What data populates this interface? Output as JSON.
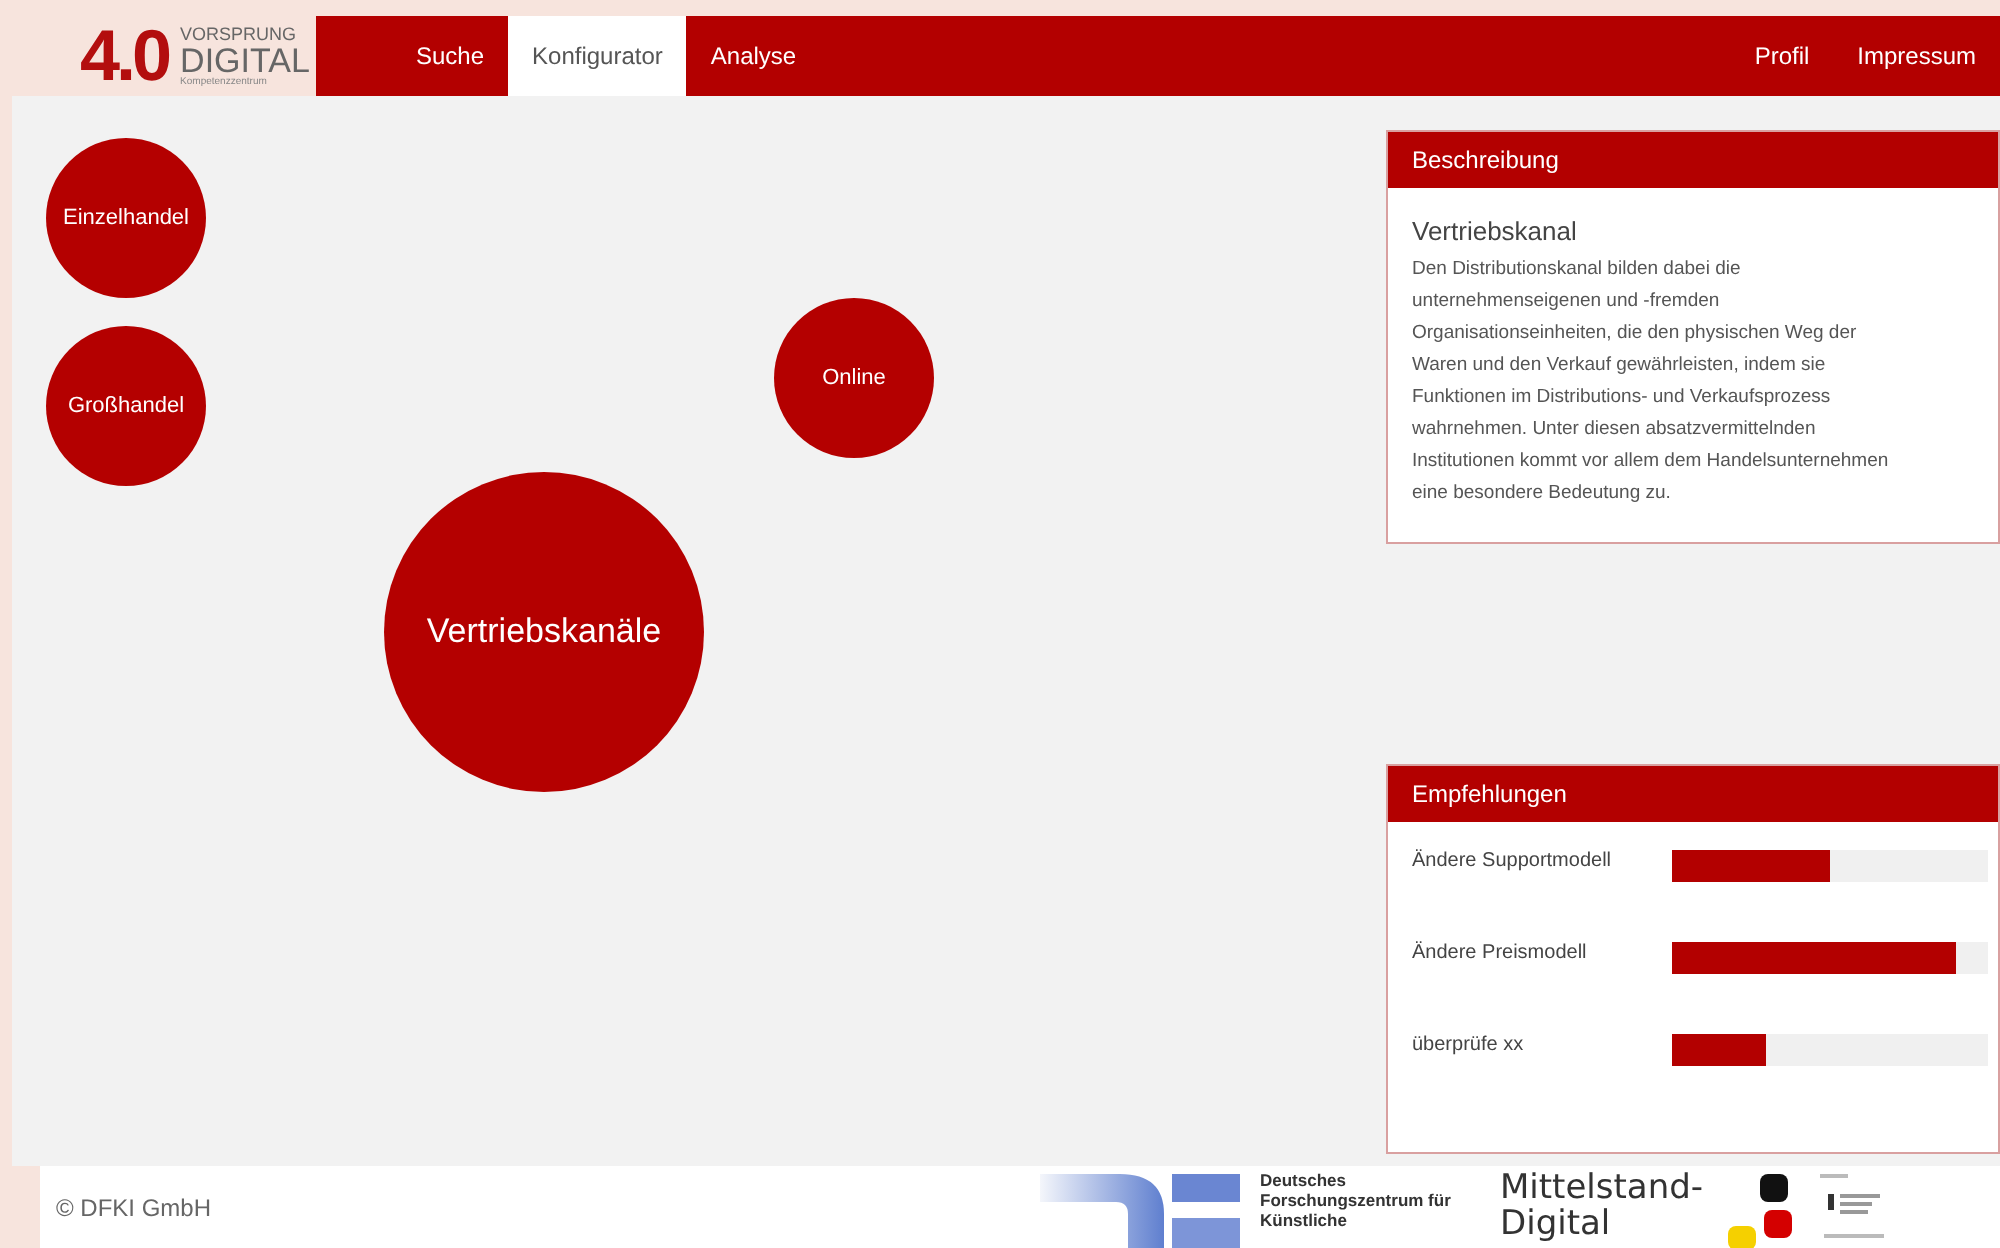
{
  "logo": {
    "number": "4.0",
    "line_1": "VORSPRUNG",
    "line_2": "DIGITAL",
    "line_3": "Kompetenzzentrum"
  },
  "nav": {
    "items": [
      {
        "label": "Suche",
        "selected": false
      },
      {
        "label": "Konfigurator",
        "selected": true
      },
      {
        "label": "Analyse",
        "selected": false
      }
    ],
    "right_items": [
      "Profil",
      "Impressum"
    ]
  },
  "nodes": [
    {
      "label": "Einzelhandel",
      "kind": "option"
    },
    {
      "label": "Großhandel",
      "kind": "option"
    },
    {
      "label": "Online",
      "kind": "option"
    },
    {
      "label": "Vertriebskanäle",
      "kind": "main"
    }
  ],
  "description": {
    "header": "Beschreibung",
    "title": "Vertriebskanal",
    "text": "Den Distributionskanal bilden dabei die unternehmenseigenen und -fremden Organisationseinheiten, die den physischen Weg der Waren und den Verkauf gewährleisten, indem sie Funktionen im Distributions- und Verkaufsprozess wahrnehmen. Unter diesen absatzvermittelnden Institutionen kommt vor allem dem Handelsunternehmen eine besondere Bedeutung zu."
  },
  "recommendations": {
    "header": "Empfehlungen",
    "items": [
      {
        "label": "Ändere Supportmodell",
        "level": 0.5
      },
      {
        "label": "Ändere Preismodell",
        "level": 0.9
      },
      {
        "label": "überprüfe xx",
        "level": 0.3
      }
    ]
  },
  "footer": {
    "copyright": "© DFKI GmbH",
    "dfki_text": "Deutsches Forschungszentrum für Künstliche",
    "mittelstand_line_1": "Mittelstand-",
    "mittelstand_line_2": "Digital"
  }
}
